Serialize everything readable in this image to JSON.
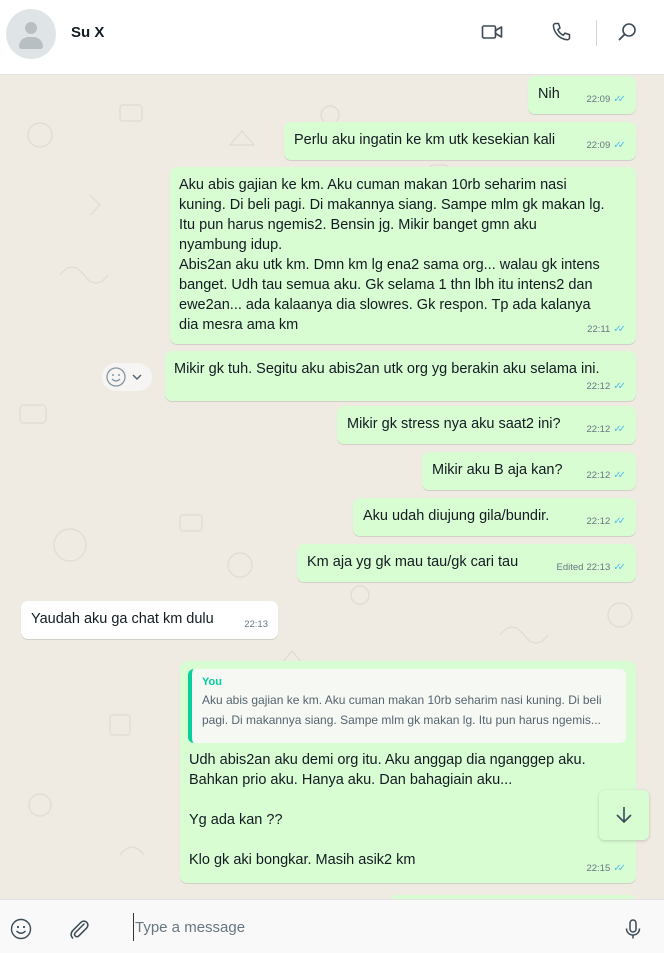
{
  "contact": {
    "name": "Su X"
  },
  "header_icons": [
    "video-call-icon",
    "voice-call-icon",
    "search-icon"
  ],
  "messages": [
    {
      "text": "Nih",
      "time": "22:09"
    },
    {
      "text": "Perlu aku ingatin ke km utk kesekian kali",
      "time": "22:09"
    },
    {
      "text": "Aku abis gajian ke km. Aku cuman makan 10rb seharim nasi\nkuning. Di beli pagi. Di makannya siang. Sampe mlm gk makan lg.\nItu pun harus ngemis2. Bensin jg. Mikir banget gmn aku\nnyambung idup.\nAbis2an aku utk km. Dmn km lg ena2 sama org... walau gk intens\nbanget. Udh tau semua aku. Gk selama 1 thn lbh itu intens2 dan\newe2an... ada kalaanya dia slowres. Gk respon. Tp ada kalanya\ndia mesra ama km",
      "time": "22:11"
    },
    {
      "text": "Mikir gk tuh. Segitu aku abis2an utk org yg berakin aku selama ini.",
      "time": "22:12"
    },
    {
      "text": "Mikir gk stress nya aku saat2 ini?",
      "time": "22:12"
    },
    {
      "text": "Mikir aku B aja kan?",
      "time": "22:12"
    },
    {
      "text": "Aku udah diujung gila/bundir.",
      "time": "22:12"
    },
    {
      "text": "Km aja yg gk mau tau/gk cari tau",
      "time": "22:13",
      "status": "Edited"
    },
    {
      "text": "Yaudah aku ga chat km dulu",
      "time": "22:13"
    },
    {
      "text": "Udh abis2an aku demi org itu. Aku anggap dia nganggep aku.\nBahkan prio aku. Hanya aku. Dan bahagiain aku...\n\nYg ada kan ??\n\nKlo gk aki bongkar. Masih asik2 km",
      "time": "22:15"
    }
  ],
  "reply_quote": {
    "author": "You",
    "text": "Aku abis gajian ke km. Aku cuman makan 10rb seharim nasi kuning. Di beli\npagi. Di makannya siang. Sampe mlm gk makan lg. Itu pun harus ngemis..."
  },
  "composer": {
    "placeholder": "Type a message"
  },
  "colors": {
    "outgoing": "#d9fdd3",
    "incoming": "#ffffff",
    "background": "#efeae2",
    "read_ticks": "#53bdeb",
    "quote_accent": "#06cf9c"
  }
}
